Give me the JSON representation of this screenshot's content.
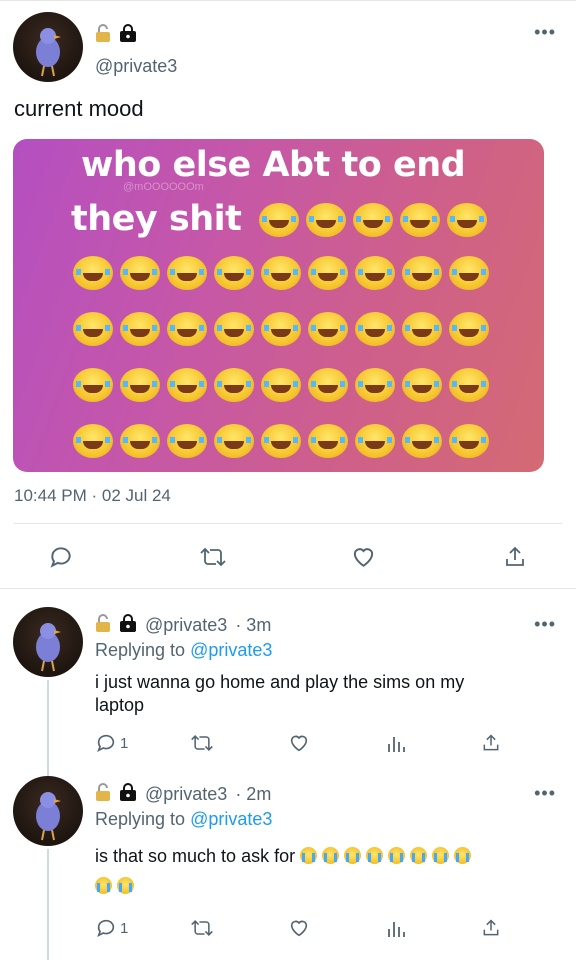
{
  "main_tweet": {
    "handle": "@private3",
    "text": "current mood",
    "media": {
      "line1": "who else Abt to end",
      "line2": "they shit",
      "watermark": "@mOOOOOOm",
      "emoji_rows": [
        5,
        9,
        9,
        9,
        9
      ]
    },
    "timestamp": "10:44 PM · 02 Jul 24",
    "more_label": "•••"
  },
  "replies": [
    {
      "handle": "@private3",
      "time": "· 3m",
      "replying_prefix": "Replying to",
      "replying_to": "@private3",
      "text_line1": "i just wanna go home and play the sims on my",
      "text_line2": "laptop",
      "reply_count": "1",
      "more_label": "•••"
    },
    {
      "handle": "@private3",
      "time": "· 2m",
      "replying_prefix": "Replying to",
      "replying_to": "@private3",
      "text": "is that so much to ask for",
      "emoji_count_line1": 8,
      "emoji_count_line2": 2,
      "reply_count": "1",
      "more_label": "•••"
    }
  ],
  "colors": {
    "muted": "#536471",
    "link": "#1d9bf0",
    "divider": "#e6e6e6",
    "media_gradient_start": "#b44fc1",
    "media_gradient_end": "#d46a74"
  },
  "icons": [
    "lock-open-icon",
    "lock-closed-icon",
    "reply-icon",
    "retweet-icon",
    "like-icon",
    "share-icon",
    "views-icon",
    "more-icon"
  ]
}
